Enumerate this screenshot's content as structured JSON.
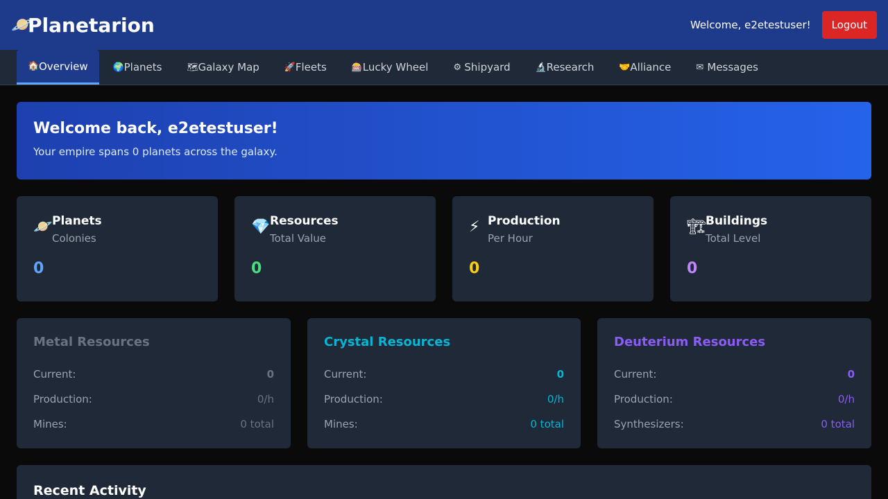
{
  "header": {
    "brand_icon": "🪐",
    "brand": "Planetarion",
    "welcome": "Welcome, e2etestuser!",
    "logout": "Logout"
  },
  "nav": {
    "items": [
      {
        "icon": "🏠",
        "label": "Overview",
        "active": true
      },
      {
        "icon": "🌍",
        "label": "Planets"
      },
      {
        "icon": "🗺",
        "label": "Galaxy Map"
      },
      {
        "icon": "🚀",
        "label": "Fleets"
      },
      {
        "icon": "🎰",
        "label": "Lucky Wheel"
      },
      {
        "icon": "⚙",
        "label": "Shipyard"
      },
      {
        "icon": "🔬",
        "label": "Research"
      },
      {
        "icon": "🤝",
        "label": "Alliance"
      },
      {
        "icon": "✉",
        "label": "Messages"
      }
    ]
  },
  "hero": {
    "title": "Welcome back, e2etestuser!",
    "subtitle": "Your empire spans 0 planets across the galaxy."
  },
  "stats": [
    {
      "icon": "🪐",
      "title": "Planets",
      "sub": "Colonies",
      "value": "0",
      "color": "#60a5fa"
    },
    {
      "icon": "💎",
      "title": "Resources",
      "sub": "Total Value",
      "value": "0",
      "color": "#4ade80"
    },
    {
      "icon": "⚡",
      "title": "Production",
      "sub": "Per Hour",
      "value": "0",
      "color": "#facc15"
    },
    {
      "icon": "🏗",
      "title": "Buildings",
      "sub": "Total Level",
      "value": "0",
      "color": "#c084fc"
    }
  ],
  "resources": [
    {
      "title": "Metal Resources",
      "color": "#6b7280",
      "rows": [
        {
          "label": "Current:",
          "value": "0"
        },
        {
          "label": "Production:",
          "value": "0/h"
        },
        {
          "label": "Mines:",
          "value": "0 total"
        }
      ]
    },
    {
      "title": "Crystal Resources",
      "color": "#06b6d4",
      "rows": [
        {
          "label": "Current:",
          "value": "0"
        },
        {
          "label": "Production:",
          "value": "0/h"
        },
        {
          "label": "Mines:",
          "value": "0 total"
        }
      ]
    },
    {
      "title": "Deuterium Resources",
      "color": "#8b5cf6",
      "rows": [
        {
          "label": "Current:",
          "value": "0"
        },
        {
          "label": "Production:",
          "value": "0/h"
        },
        {
          "label": "Synthesizers:",
          "value": "0 total"
        }
      ]
    }
  ],
  "activity": {
    "title": "Recent Activity"
  }
}
